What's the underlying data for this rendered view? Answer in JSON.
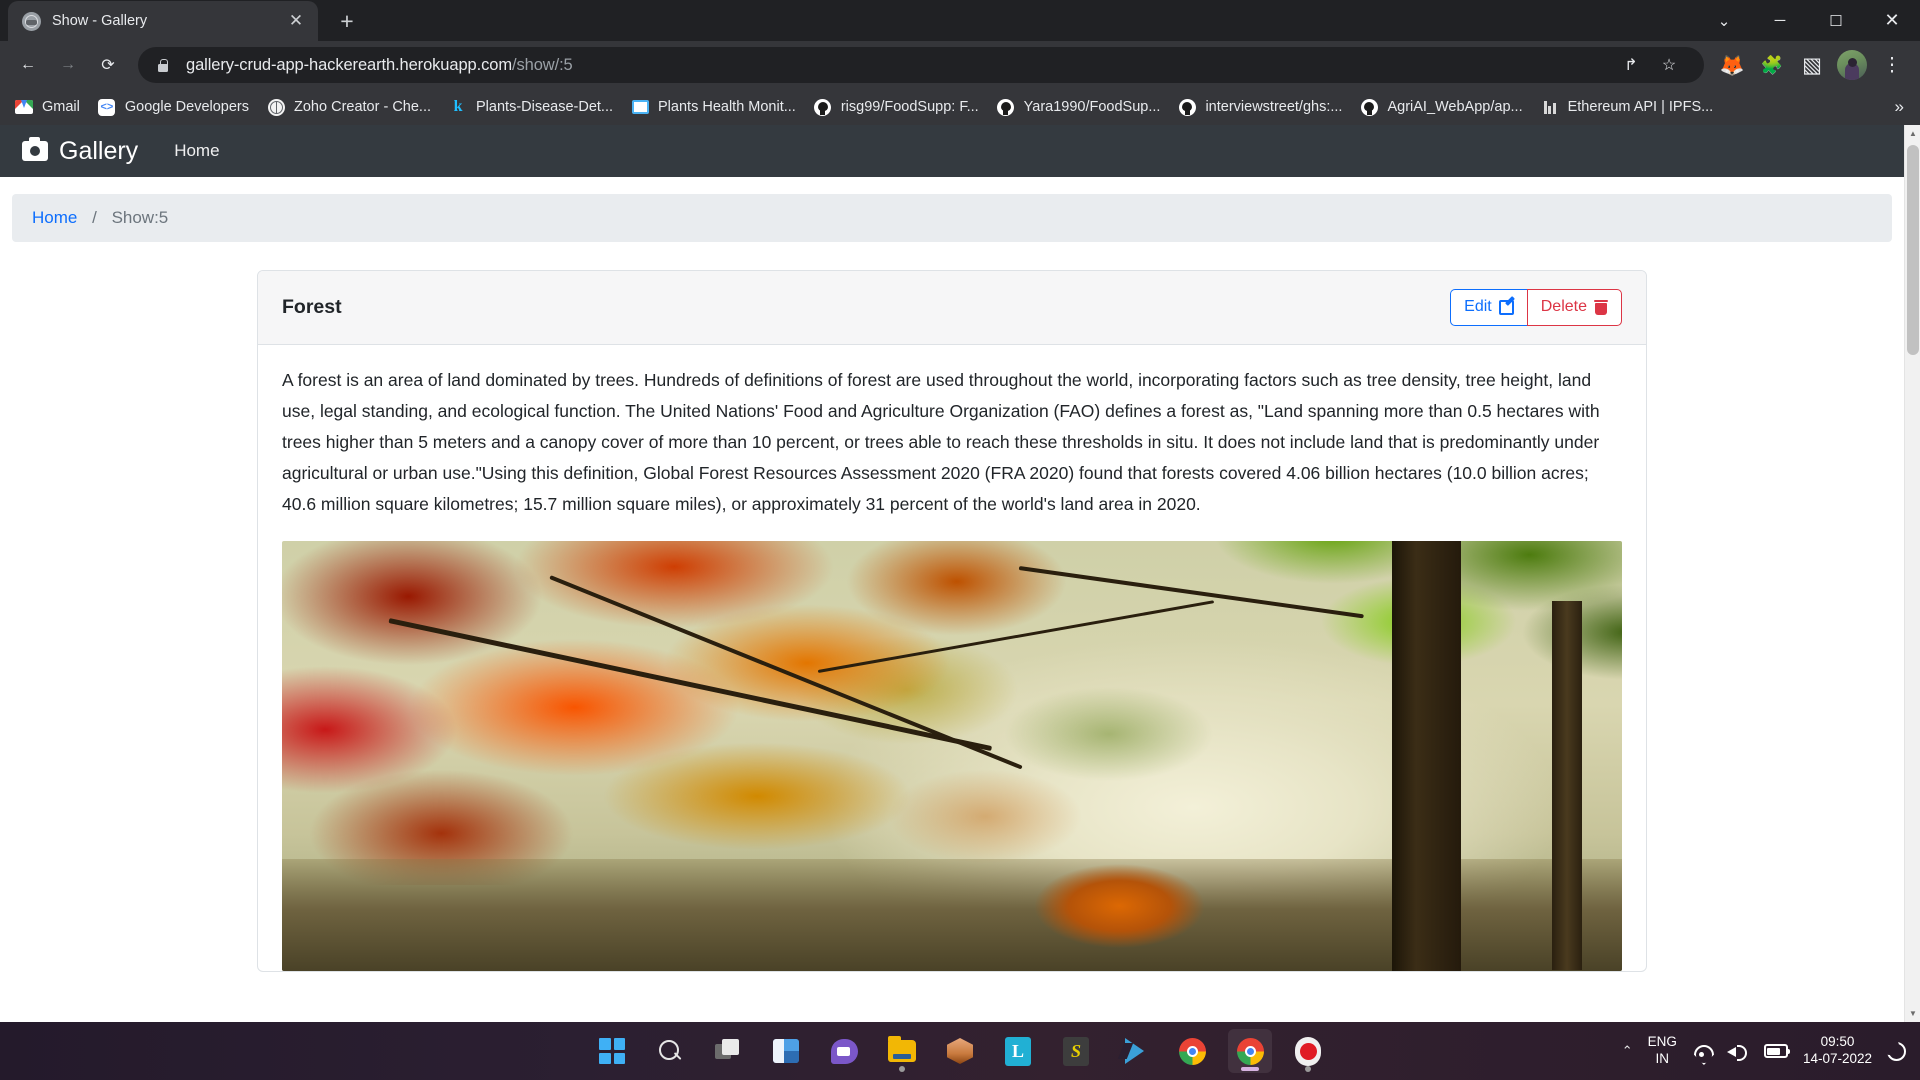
{
  "browser": {
    "tab": {
      "title": "Show - Gallery",
      "favicon": "globe-icon",
      "close": "✕"
    },
    "new_tab": "+",
    "window_controls": {
      "minimize_all": "⌄",
      "minimize": "─",
      "maximize": "☐",
      "close": "✕"
    },
    "nav": {
      "back": "←",
      "forward": "→",
      "reload": "⟳"
    },
    "omnibox": {
      "lock": "lock-icon",
      "url_host": "gallery-crud-app-hackerearth.herokuapp.com",
      "url_path": "/show/:5",
      "share": "↱",
      "bookmark_star": "☆"
    },
    "toolbar_icons": [
      {
        "name": "metamask-extension-icon",
        "glyph": "🦊"
      },
      {
        "name": "extensions-icon",
        "glyph": "🧩"
      },
      {
        "name": "side-panel-icon",
        "glyph": "▧"
      }
    ],
    "profile_avatar": "user-avatar",
    "menu": "⋮",
    "bookmarks": [
      {
        "label": "Gmail",
        "icon": "gmail-icon"
      },
      {
        "label": "Google Developers",
        "icon": "google-developers-icon"
      },
      {
        "label": "Zoho Creator - Che...",
        "icon": "zoho-globe-icon"
      },
      {
        "label": "Plants-Disease-Det...",
        "icon": "kaggle-icon"
      },
      {
        "label": "Plants Health Monit...",
        "icon": "monitor-icon"
      },
      {
        "label": "risg99/FoodSupp: F...",
        "icon": "github-icon"
      },
      {
        "label": "Yara1990/FoodSup...",
        "icon": "github-icon"
      },
      {
        "label": "interviewstreet/ghs:...",
        "icon": "github-icon"
      },
      {
        "label": "AgriAI_WebApp/ap...",
        "icon": "github-icon"
      },
      {
        "label": "Ethereum API | IPFS...",
        "icon": "ethereum-api-icon"
      }
    ],
    "bookmarks_overflow": "»"
  },
  "site": {
    "navbar": {
      "brand": "Gallery",
      "brand_icon": "camera-icon",
      "links": [
        {
          "label": "Home"
        }
      ]
    },
    "breadcrumb": {
      "home": "Home",
      "separator": "/",
      "current": "Show:5"
    },
    "card": {
      "title": "Forest",
      "edit_label": "Edit",
      "edit_icon": "pencil-icon",
      "delete_label": "Delete",
      "delete_icon": "trash-icon",
      "body": "A forest is an area of land dominated by trees. Hundreds of definitions of forest are used throughout the world, incorporating factors such as tree density, tree height, land use, legal standing, and ecological function. The United Nations' Food and Agriculture Organization (FAO) defines a forest as, \"Land spanning more than 0.5 hectares with trees higher than 5 meters and a canopy cover of more than 10 percent, or trees able to reach these thresholds in situ. It does not include land that is predominantly under agricultural or urban use.\"Using this definition, Global Forest Resources Assessment 2020 (FRA 2020) found that forests covered 4.06 billion hectares (10.0 billion acres; 40.6 million square kilometres; 15.7 million square miles), or approximately 31 percent of the world's land area in 2020.",
      "image_alt": "autumn-forest-photo"
    },
    "scrollbar": {
      "up": "▲",
      "down": "▼"
    }
  },
  "taskbar": {
    "apps": [
      {
        "name": "start-button",
        "label": "Start"
      },
      {
        "name": "search-icon",
        "label": "Search"
      },
      {
        "name": "task-view-icon",
        "label": "Task View"
      },
      {
        "name": "widgets-icon",
        "label": "Widgets"
      },
      {
        "name": "teams-chat-icon",
        "label": "Chat"
      },
      {
        "name": "file-explorer-icon",
        "label": "File Explorer"
      },
      {
        "name": "package-app-icon",
        "label": "Package"
      },
      {
        "name": "lambdatest-icon",
        "label": "L"
      },
      {
        "name": "sublime-text-icon",
        "label": "S"
      },
      {
        "name": "vs-code-icon",
        "label": "Visual Studio Code"
      },
      {
        "name": "chrome-icon",
        "label": "Google Chrome"
      },
      {
        "name": "chrome-active-icon",
        "label": "Google Chrome"
      },
      {
        "name": "screen-recorder-icon",
        "label": "Recorder"
      }
    ],
    "tray": {
      "chevron": "⌃",
      "language_line1": "ENG",
      "language_line2": "IN",
      "wifi": "wifi-icon",
      "volume": "volume-icon",
      "battery": "battery-icon",
      "time": "09:50",
      "date": "14-07-2022",
      "moon": "do-not-disturb-icon"
    }
  },
  "colors": {
    "chrome_bg": "#202124",
    "chrome_toolbar": "#35363a",
    "link_blue": "#0d6efd",
    "danger_red": "#dc3545",
    "navbar_dark": "#343a40",
    "breadcrumb_bg": "#e9ecef"
  }
}
